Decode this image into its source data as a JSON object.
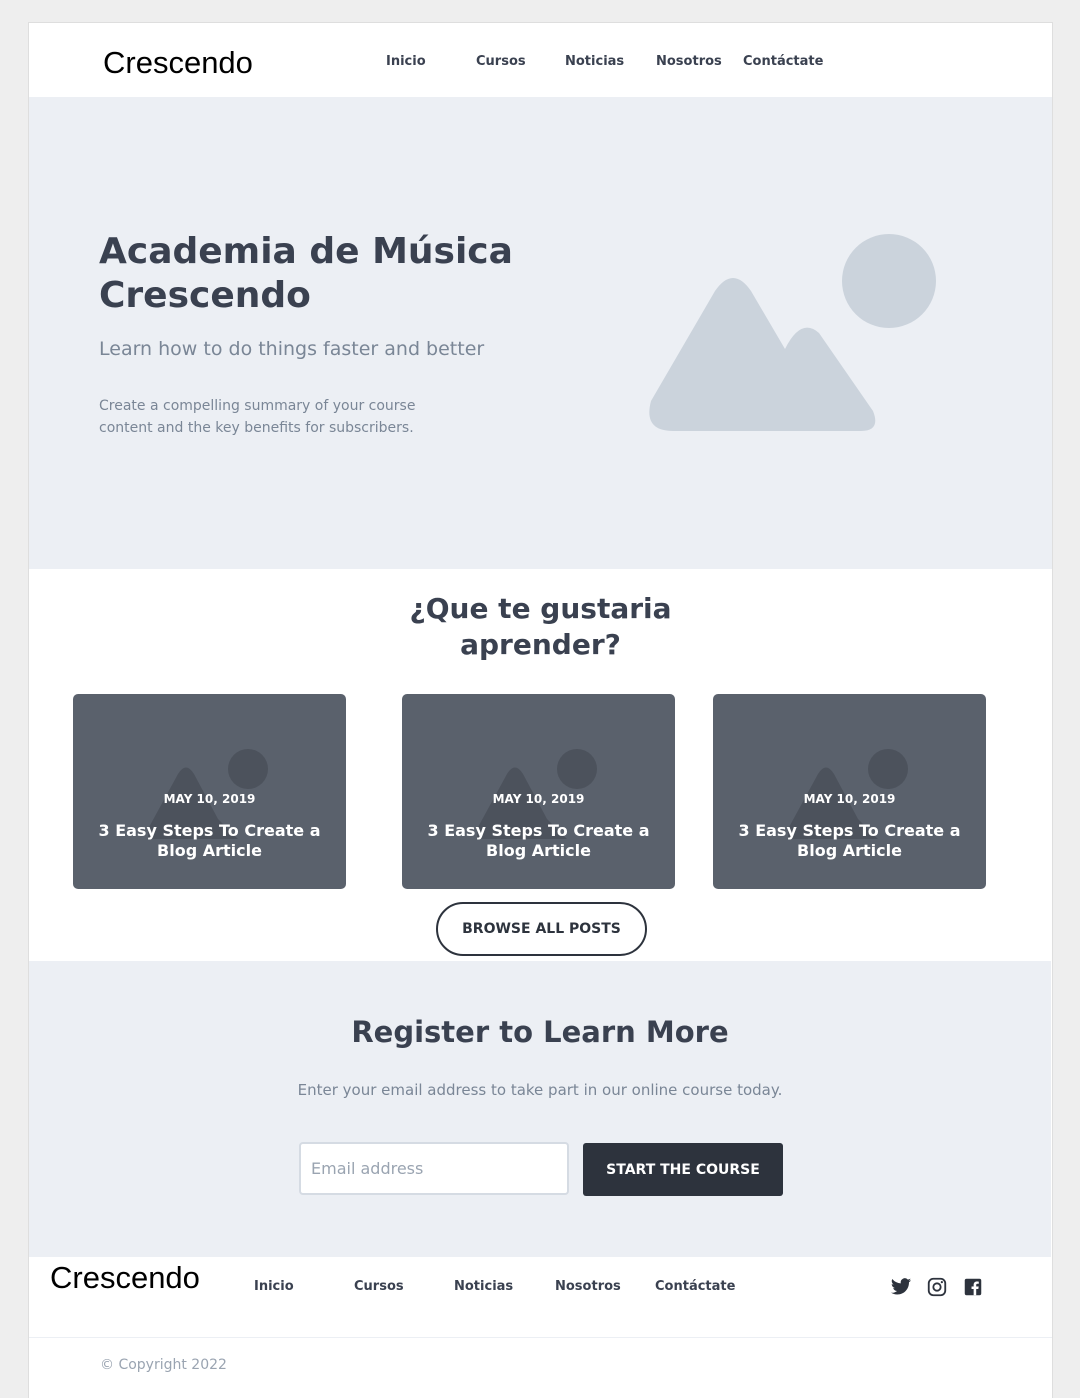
{
  "brand": {
    "name": "Crescendo"
  },
  "nav": {
    "items": [
      {
        "label": "Inicio"
      },
      {
        "label": "Cursos"
      },
      {
        "label": "Noticias"
      },
      {
        "label": "Nosotros"
      },
      {
        "label": "Contáctate"
      }
    ]
  },
  "hero": {
    "title": "Academia de Música Crescendo",
    "subtitle": "Learn how to do things faster and better",
    "description": "Create a compelling summary of your course content and the key benefits for subscribers.",
    "image_icon": "image-placeholder-icon"
  },
  "learn": {
    "title_line1": "¿Que te gustaria",
    "title_line2": "aprender?",
    "posts": [
      {
        "date": "MAY 10, 2019",
        "title": "3 Easy Steps To Create a Blog Article"
      },
      {
        "date": "MAY 10, 2019",
        "title": "3 Easy Steps To Create a Blog Article"
      },
      {
        "date": "MAY 10, 2019",
        "title": "3 Easy Steps To Create a Blog Article"
      }
    ],
    "browse_label": "BROWSE ALL POSTS"
  },
  "register": {
    "title": "Register to Learn More",
    "description": "Enter your email address to take part in our online course today.",
    "email_placeholder": "Email address",
    "button_label": "START THE COURSE"
  },
  "footer": {
    "brand": "Crescendo",
    "nav": [
      {
        "label": "Inicio"
      },
      {
        "label": "Cursos"
      },
      {
        "label": "Noticias"
      },
      {
        "label": "Nosotros"
      },
      {
        "label": "Contáctate"
      }
    ],
    "social_icons": [
      "twitter-icon",
      "instagram-icon",
      "facebook-icon"
    ],
    "copyright": "© Copyright 2022"
  },
  "colors": {
    "hero_bg": "#eceff4",
    "text_dark": "#3a4150",
    "text_muted": "#7a8696",
    "card_bg": "#5a616c",
    "button_dark": "#2d333d",
    "placeholder_shape": "#cbd3dc"
  }
}
